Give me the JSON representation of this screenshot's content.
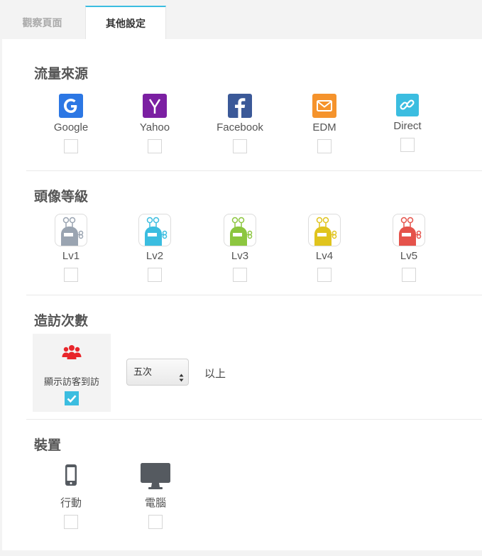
{
  "tabs": [
    {
      "label": "觀察頁面",
      "active": false
    },
    {
      "label": "其他設定",
      "active": true
    }
  ],
  "sections": {
    "traffic": {
      "title": "流量來源",
      "items": [
        {
          "label": "Google",
          "icon": "google-icon",
          "color": "#2c77e4",
          "checked": false
        },
        {
          "label": "Yahoo",
          "icon": "yahoo-icon",
          "color": "#7b1fa2",
          "checked": false
        },
        {
          "label": "Facebook",
          "icon": "facebook-icon",
          "color": "#3b5998",
          "checked": false
        },
        {
          "label": "EDM",
          "icon": "mail-icon",
          "color": "#f5932c",
          "checked": false
        },
        {
          "label": "Direct",
          "icon": "link-icon",
          "color": "#3bbde0",
          "checked": false
        }
      ]
    },
    "avatar": {
      "title": "頭像等級",
      "items": [
        {
          "label": "Lv1",
          "color": "#9aa4b1",
          "checked": false
        },
        {
          "label": "Lv2",
          "color": "#3bbde0",
          "checked": false
        },
        {
          "label": "Lv3",
          "color": "#8cc63f",
          "checked": false
        },
        {
          "label": "Lv4",
          "color": "#e0c41e",
          "checked": false
        },
        {
          "label": "Lv5",
          "color": "#e5534b",
          "checked": false
        }
      ]
    },
    "visits": {
      "title": "造訪次數",
      "card_label": "顯示訪客到訪",
      "card_icon": "users-icon",
      "card_icon_color": "#e8262b",
      "card_checked": true,
      "select_value": "五次",
      "suffix": "以上"
    },
    "device": {
      "title": "裝置",
      "items": [
        {
          "label": "行動",
          "icon": "mobile-icon",
          "checked": false
        },
        {
          "label": "電腦",
          "icon": "desktop-icon",
          "checked": false
        }
      ]
    }
  },
  "colors": {
    "accent": "#3bbde0",
    "icon_gray": "#555a60"
  }
}
